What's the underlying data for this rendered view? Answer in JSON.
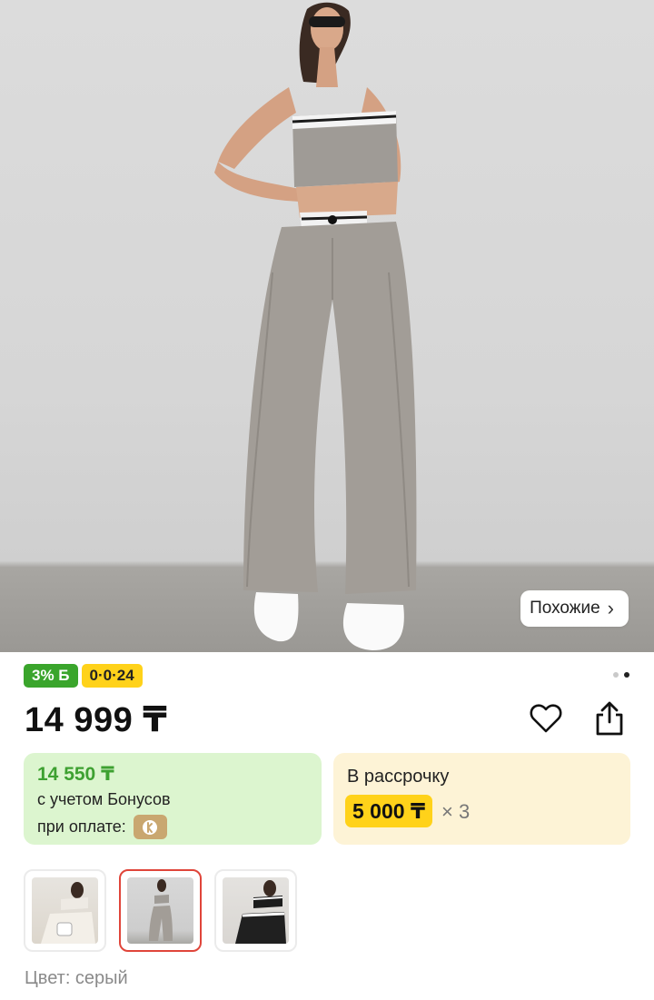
{
  "hero": {
    "similar_label": "Похожие",
    "pager": {
      "total": 2,
      "active": 2
    }
  },
  "badges": {
    "bonus": "3% Б",
    "installment": "0·0·24"
  },
  "product": {
    "price": "14 999 ₸",
    "color_label": "Цвет: серый"
  },
  "bonus_card": {
    "price": "14 550 ₸",
    "line1": "с учетом Бонусов",
    "line2": "при оплате:"
  },
  "installment_card": {
    "title": "В рассрочку",
    "amount": "5 000 ₸",
    "multiplier": "× 3"
  },
  "thumbnails": [
    {
      "selected": false
    },
    {
      "selected": true
    },
    {
      "selected": false
    }
  ],
  "colors": {
    "bonus_green": "#3aa52c",
    "accent_yellow": "#ffd21a",
    "selected_border": "#e0453a"
  }
}
